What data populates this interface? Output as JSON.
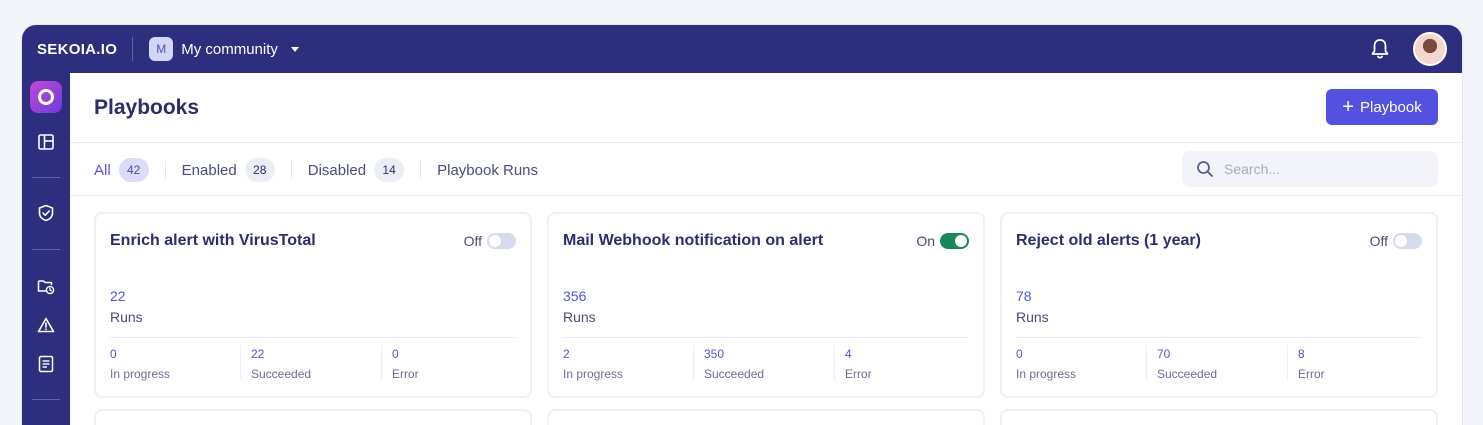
{
  "topbar": {
    "brand": "SEKOIA.IO",
    "community_badge": "M",
    "community_name": "My community"
  },
  "page": {
    "title": "Playbooks",
    "add_button_label": "Playbook"
  },
  "tabs": [
    {
      "label": "All",
      "count": "42"
    },
    {
      "label": "Enabled",
      "count": "28"
    },
    {
      "label": "Disabled",
      "count": "14"
    },
    {
      "label": "Playbook Runs"
    }
  ],
  "search": {
    "placeholder": "Search..."
  },
  "cards": [
    {
      "title": "Enrich alert with VirusTotal",
      "toggle_label": "Off",
      "enabled": false,
      "runs": "22",
      "runs_label": "Runs",
      "stats": [
        {
          "value": "0",
          "label": "In progress"
        },
        {
          "value": "22",
          "label": "Succeeded"
        },
        {
          "value": "0",
          "label": "Error"
        }
      ]
    },
    {
      "title": "Mail Webhook notification on alert",
      "toggle_label": "On",
      "enabled": true,
      "runs": "356",
      "runs_label": "Runs",
      "stats": [
        {
          "value": "2",
          "label": "In progress"
        },
        {
          "value": "350",
          "label": "Succeeded"
        },
        {
          "value": "4",
          "label": "Error"
        }
      ]
    },
    {
      "title": "Reject old alerts (1 year)",
      "toggle_label": "Off",
      "enabled": false,
      "runs": "78",
      "runs_label": "Runs",
      "stats": [
        {
          "value": "0",
          "label": "In progress"
        },
        {
          "value": "70",
          "label": "Succeeded"
        },
        {
          "value": "8",
          "label": "Error"
        }
      ]
    }
  ],
  "colors": {
    "nav": "#2e2e7e",
    "accent": "#5352e0",
    "toggle_on": "#17875c"
  },
  "icons": [
    "bell-icon",
    "dashboard-icon",
    "shield-check-icon",
    "folder-clock-icon",
    "warning-icon",
    "report-list-icon",
    "search-icon",
    "plus-icon"
  ]
}
